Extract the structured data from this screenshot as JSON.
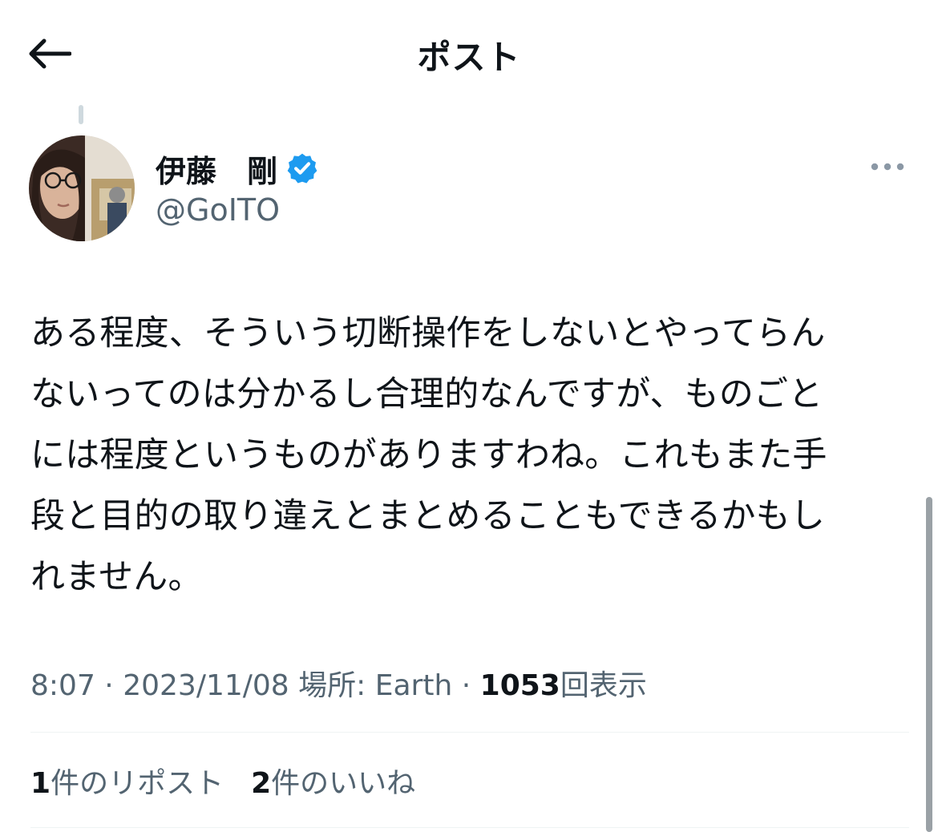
{
  "header": {
    "title": "ポスト",
    "back_icon": "arrow-left-icon"
  },
  "author": {
    "display_name": "伊藤　剛",
    "handle": "@GoITO",
    "verified": true,
    "verified_color": "#1d9bf0"
  },
  "post": {
    "lines": [
      "ある程度、そういう切断操作をしないとやってらん",
      "ないってのは分かるし合理的なんですが、ものごと",
      "には程度というものがありますわね。これもまた手",
      "段と目的の取り違えとまとめることもできるかもし",
      "れません。"
    ]
  },
  "meta": {
    "time": "8:07",
    "separator": "·",
    "date": "2023/11/08",
    "location_label": "場所: Earth",
    "views_count": "1053",
    "views_label": "回表示"
  },
  "stats": {
    "reposts_count": "1",
    "reposts_label": "件のリポスト",
    "likes_count": "2",
    "likes_label": "件のいいね"
  },
  "colors": {
    "text_primary": "#0f1419",
    "text_secondary": "#536471",
    "divider": "#eff3f4",
    "accent": "#1d9bf0"
  }
}
